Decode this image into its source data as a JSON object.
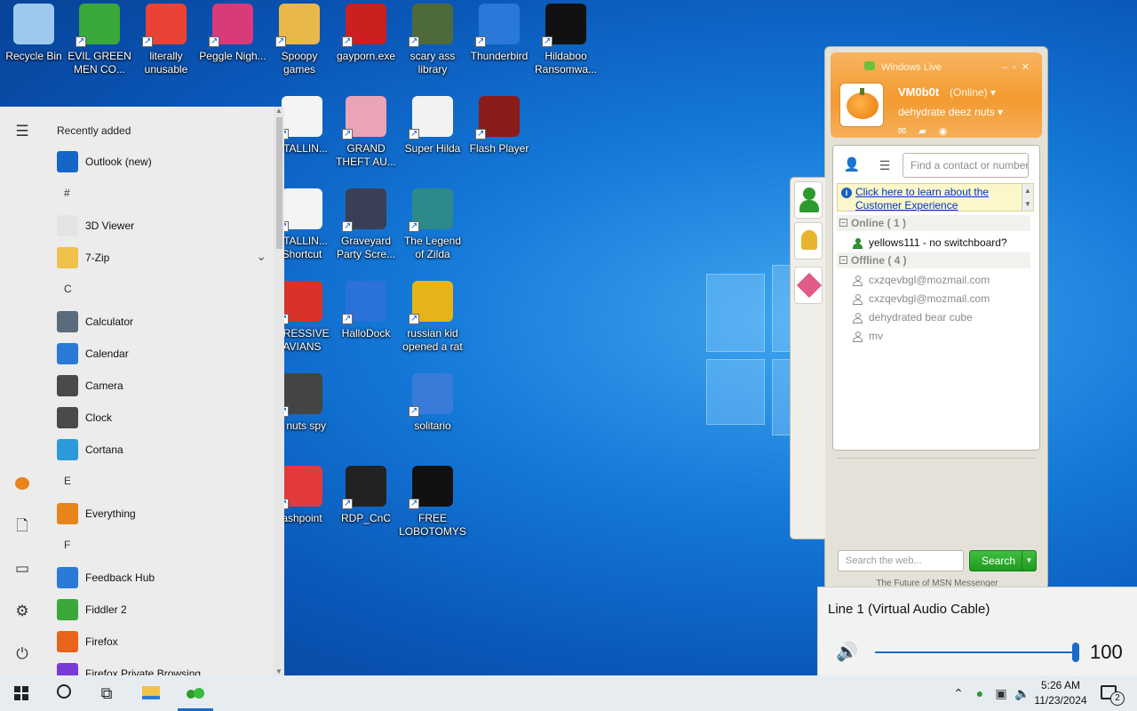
{
  "desktop": {
    "icons": [
      {
        "label": "Recycle Bin",
        "icon": "recycle-bin-icon",
        "color": "#9ec9ee"
      },
      {
        "label": "EVIL GREEN MEN CO...",
        "icon": "messenger-people-icon",
        "color": "#3aa83a"
      },
      {
        "label": "literally unusable",
        "icon": "chrome-icon",
        "color": "#ea4335"
      },
      {
        "label": "Peggle Nigh...",
        "icon": "peggle-icon",
        "color": "#d93a7a"
      },
      {
        "label": "Spoopy games",
        "icon": "folder-icon",
        "color": "#e9b84a"
      },
      {
        "label": "gayporn.exe",
        "icon": "flash-icon",
        "color": "#cc1f1f"
      },
      {
        "label": "scary ass library",
        "icon": "library-icon",
        "color": "#4f6a3a"
      },
      {
        "label": "Thunderbird",
        "icon": "thunderbird-icon",
        "color": "#2a79d8"
      },
      {
        "label": "Hildaboo Ransomwa...",
        "icon": "yashma-icon",
        "color": "#111111"
      },
      {
        "label": "STALLIN...",
        "icon": "document-icon",
        "color": "#f4f4f4"
      },
      {
        "label": "GRAND THEFT AU...",
        "icon": "anime-girl-icon",
        "color": "#e9a4b8"
      },
      {
        "label": "Super Hilda",
        "icon": "pixel-game-icon",
        "color": "#f2f2f2"
      },
      {
        "label": "Flash Player",
        "icon": "flash-player-icon",
        "color": "#8a1b1b"
      },
      {
        "label": "STALLIN... Shortcut",
        "icon": "document-icon",
        "color": "#f4f4f4"
      },
      {
        "label": "Graveyard Party Scre...",
        "icon": "graveyard-icon",
        "color": "#3a3f55"
      },
      {
        "label": "The Legend of Zilda",
        "icon": "zilda-icon",
        "color": "#2e8a8a"
      },
      {
        "label": "GRESSIVE AVIANS",
        "icon": "angry-bird-icon",
        "color": "#d8322a"
      },
      {
        "label": "HalloDock",
        "icon": "shield-icon",
        "color": "#2a72d8"
      },
      {
        "label": "russian kid opened a rat",
        "icon": "dev-icon",
        "color": "#e6b418"
      },
      {
        "label": "z nuts spy",
        "icon": "stack-icon",
        "color": "#444444"
      },
      {
        "label": "solitario",
        "icon": "cards-icon",
        "color": "#3a7ad8"
      },
      {
        "label": "ashpoint",
        "icon": "flashpoint-icon",
        "color": "#e23a3a"
      },
      {
        "label": "RDP_CnC",
        "icon": "rdp-icon",
        "color": "#222222"
      },
      {
        "label": "FREE LOBOTOMYS",
        "icon": "lobotomy-icon",
        "color": "#111111"
      }
    ]
  },
  "start_menu": {
    "recently_added": "Recently added",
    "items": [
      {
        "label": "Outlook (new)",
        "icon": "outlook-icon",
        "color": "#1466c8"
      },
      {
        "letter": "#"
      },
      {
        "label": "3D Viewer",
        "icon": "cube-icon",
        "color": "#e4e4e4"
      },
      {
        "label": "7-Zip",
        "icon": "folder-icon",
        "color": "#f0c24a"
      },
      {
        "letter": "C"
      },
      {
        "label": "Calculator",
        "icon": "calculator-icon",
        "color": "#5a6b7c"
      },
      {
        "label": "Calendar",
        "icon": "calendar-icon",
        "color": "#2a7ad8"
      },
      {
        "label": "Camera",
        "icon": "camera-icon",
        "color": "#4a4a4a"
      },
      {
        "label": "Clock",
        "icon": "clock-icon",
        "color": "#4a4a4a"
      },
      {
        "label": "Cortana",
        "icon": "cortana-icon",
        "color": "#2a9ad8"
      },
      {
        "letter": "E"
      },
      {
        "label": "Everything",
        "icon": "magnifier-icon",
        "color": "#e8841a"
      },
      {
        "letter": "F"
      },
      {
        "label": "Feedback Hub",
        "icon": "feedback-icon",
        "color": "#2a7ad8"
      },
      {
        "label": "Fiddler 2",
        "icon": "fiddler-icon",
        "color": "#3aa83a"
      },
      {
        "label": "Firefox",
        "icon": "firefox-icon",
        "color": "#e8641a"
      },
      {
        "label": "Firefox Private Browsing",
        "icon": "firefox-private-icon",
        "color": "#7a3ad8"
      }
    ]
  },
  "messenger": {
    "title": "Windows Live",
    "username": "VM0b0t",
    "status": "(Online)",
    "personal_message": "dehydrate deez nuts",
    "search_placeholder": "Find a contact or number",
    "banner_text": "Click here to learn about the Customer Experience",
    "groups": [
      {
        "name": "Online ( 1 )",
        "contacts": [
          {
            "name": "yellows111 - no switchboard?",
            "online": true
          }
        ]
      },
      {
        "name": "Offline ( 4 )",
        "contacts": [
          {
            "name": "cxzqevbgl@mozmail.com",
            "online": false
          },
          {
            "name": "cxzqevbgl@mozmail.com",
            "online": false
          },
          {
            "name": "dehydrated bear cube",
            "online": false
          },
          {
            "name": "mv",
            "online": false
          }
        ]
      }
    ],
    "web_search_placeholder": "Search the web...",
    "search_button": "Search",
    "footer": "The Future of MSN Messenger",
    "accent": "#f39a30"
  },
  "volume": {
    "device": "Line 1 (Virtual Audio Cable)",
    "level": 100,
    "level_text": "100"
  },
  "taskbar": {
    "time": "5:26 AM",
    "date": "11/23/2024",
    "notifications": "2"
  }
}
